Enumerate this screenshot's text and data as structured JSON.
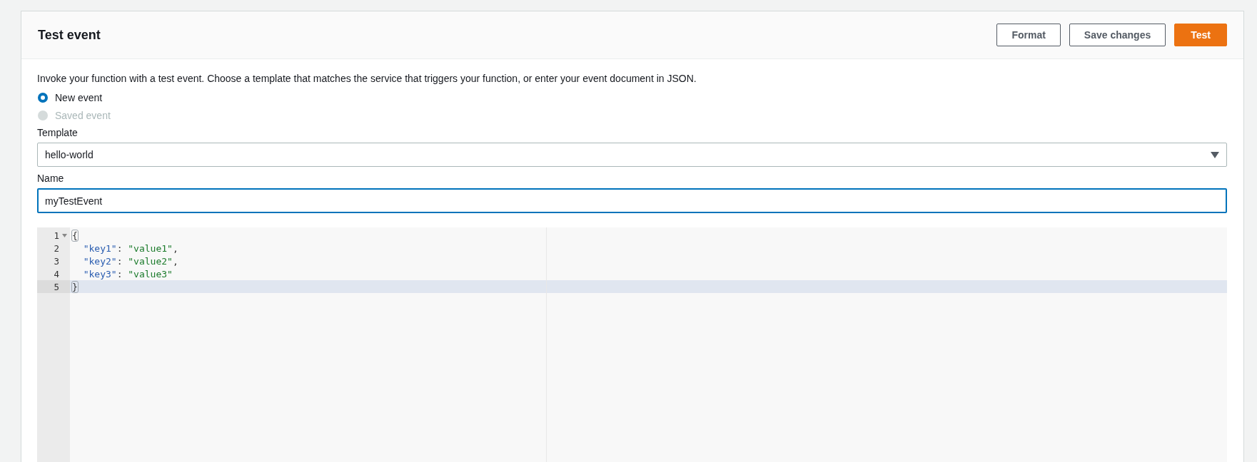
{
  "panel": {
    "title": "Test event",
    "buttons": [
      {
        "label": "Format",
        "kind": "normal"
      },
      {
        "label": "Save changes",
        "kind": "normal"
      },
      {
        "label": "Test",
        "kind": "primary"
      }
    ]
  },
  "description": "Invoke your function with a test event. Choose a template that matches the service that triggers your function, or enter your event document in JSON.",
  "event_source": [
    {
      "label": "New event",
      "selected": true,
      "disabled": false
    },
    {
      "label": "Saved event",
      "selected": false,
      "disabled": true
    }
  ],
  "template": {
    "label": "Template",
    "value": "hello-world"
  },
  "name": {
    "label": "Name",
    "value": "myTestEvent",
    "focused": true
  },
  "editor": {
    "lines": [
      {
        "number": "1",
        "foldable": true,
        "active": false,
        "tokens": [
          {
            "kind": "matched-bracket",
            "text": "{"
          }
        ]
      },
      {
        "number": "2",
        "foldable": false,
        "active": false,
        "tokens": [
          {
            "kind": "key",
            "text": "  \"key1\""
          },
          {
            "kind": "punct",
            "text": ": "
          },
          {
            "kind": "string",
            "text": "\"value1\""
          },
          {
            "kind": "punct",
            "text": ","
          }
        ]
      },
      {
        "number": "3",
        "foldable": false,
        "active": false,
        "tokens": [
          {
            "kind": "key",
            "text": "  \"key2\""
          },
          {
            "kind": "punct",
            "text": ": "
          },
          {
            "kind": "string",
            "text": "\"value2\""
          },
          {
            "kind": "punct",
            "text": ","
          }
        ]
      },
      {
        "number": "4",
        "foldable": false,
        "active": false,
        "tokens": [
          {
            "kind": "key",
            "text": "  \"key3\""
          },
          {
            "kind": "punct",
            "text": ": "
          },
          {
            "kind": "string",
            "text": "\"value3\""
          }
        ]
      },
      {
        "number": "5",
        "foldable": false,
        "active": true,
        "tokens": [
          {
            "kind": "matched-bracket",
            "text": "}"
          }
        ]
      }
    ]
  }
}
